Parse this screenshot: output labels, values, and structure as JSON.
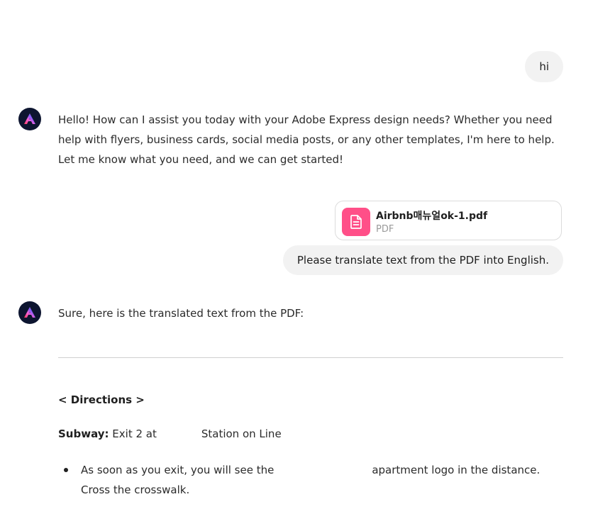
{
  "conversation": {
    "user_message_1": "hi",
    "assistant_message_1": "Hello! How can I assist you today with your Adobe Express design needs? Whether you need help with flyers, business cards, social media posts, or any other templates, I'm here to help. Let me know what you need, and we can get started!",
    "attachment": {
      "file_name": "Airbnb매뉴얼ok-1.pdf",
      "file_type": "PDF"
    },
    "user_message_2": "Please translate text from the PDF into English.",
    "assistant_message_2": "Sure, here is the translated text from the PDF:"
  },
  "document": {
    "directions_heading": "< Directions >",
    "subway_label": "Subway:",
    "subway_text_1": "Exit 2 at",
    "subway_text_2": "Station on Line",
    "bullet_1_part_1": "As soon as you exit, you will see the",
    "bullet_1_part_2": "apartment logo in the distance. Cross the crosswalk."
  },
  "icons": {
    "assistant_avatar": "adobe-express-logo-icon",
    "attachment_icon": "document-icon"
  },
  "colors": {
    "user_bubble": "#f2f2f2",
    "avatar_bg": "#0d1530",
    "file_icon_bg": "#ff4f88",
    "divider": "#cfcfcf"
  }
}
